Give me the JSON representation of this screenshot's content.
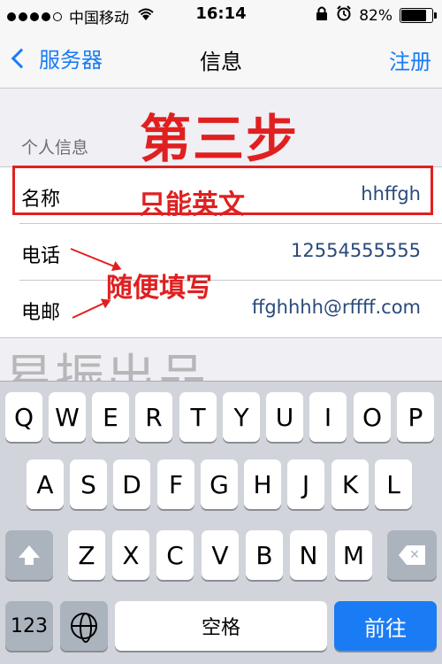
{
  "status": {
    "carrier": "中国移动",
    "time": "16:14",
    "battery_percent": "82%",
    "battery_level": 0.82
  },
  "nav": {
    "back_label": "服务器",
    "title": "信息",
    "right_label": "注册"
  },
  "annotations": {
    "step": "第三步",
    "english_only": "只能英文",
    "fill_freely": "随便填写",
    "watermark": "易振出品"
  },
  "form": {
    "section_header": "个人信息",
    "rows": [
      {
        "label": "名称",
        "value": "hhffgh"
      },
      {
        "label": "电话",
        "value": "12554555555"
      },
      {
        "label": "电邮",
        "value": "ffghhhh@rffff.com"
      }
    ]
  },
  "keyboard": {
    "row1": [
      "Q",
      "W",
      "E",
      "R",
      "T",
      "Y",
      "U",
      "I",
      "O",
      "P"
    ],
    "row2": [
      "A",
      "S",
      "D",
      "F",
      "G",
      "H",
      "J",
      "K",
      "L"
    ],
    "row3": [
      "Z",
      "X",
      "C",
      "V",
      "B",
      "N",
      "M"
    ],
    "numbers_key": "123",
    "space_key": "空格",
    "go_key": "前往"
  }
}
